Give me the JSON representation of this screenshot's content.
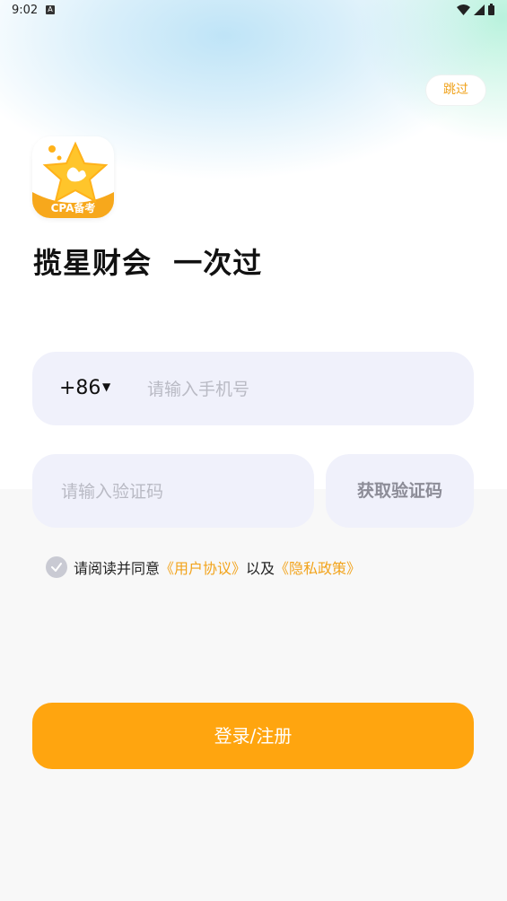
{
  "status_bar": {
    "time": "9:02",
    "notification_icon": "a-badge-icon"
  },
  "header": {
    "skip_label": "跳过"
  },
  "brand": {
    "logo_text": "CPA备考",
    "slogan": "揽星财会  一次过"
  },
  "form": {
    "country_code": "+86",
    "phone_placeholder": "请输入手机号",
    "code_placeholder": "请输入验证码",
    "get_code_label": "获取验证码"
  },
  "agreement": {
    "prefix": "请阅读并同意",
    "user_agreement": "《用户协议》",
    "middle": "以及",
    "privacy_policy": "《隐私政策》"
  },
  "login_button_label": "登录/注册",
  "colors": {
    "accent": "#ffa50f",
    "link": "#f2a31b",
    "input_bg": "#f0f1fb"
  }
}
